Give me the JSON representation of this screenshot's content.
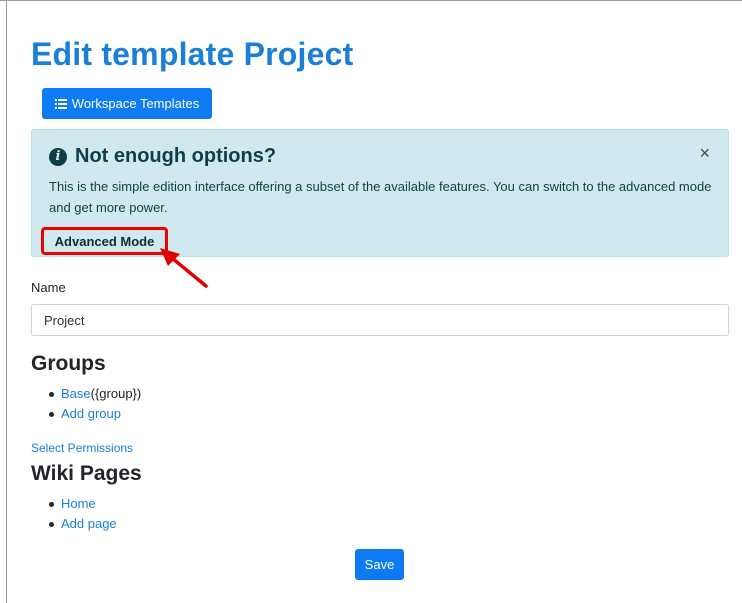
{
  "page": {
    "title": "Edit template Project"
  },
  "toolbar": {
    "templates_label": "Workspace Templates",
    "templates_icon": "list-icon"
  },
  "alert": {
    "heading": "Not enough options?",
    "close": "×",
    "text": "This is the simple edition interface offering a subset of the available features. You can switch to the advanced mode and get more power.",
    "advanced_label": "Advanced Mode",
    "highlight_color": "#e00000"
  },
  "form": {
    "name_label": "Name",
    "name_value": "Project"
  },
  "groups": {
    "heading": "Groups",
    "items": [
      {
        "link": "Base",
        "suffix": " ({group})"
      },
      {
        "link": "Add group",
        "suffix": ""
      }
    ]
  },
  "permissions_link": "Select Permissions",
  "wiki": {
    "heading": "Wiki Pages",
    "items": [
      {
        "link": "Home"
      },
      {
        "link": "Add page"
      }
    ]
  },
  "save_label": "Save",
  "colors": {
    "primary": "#0d7bf2",
    "link": "#1a7fd6",
    "alert_bg": "#d0e9ee"
  }
}
